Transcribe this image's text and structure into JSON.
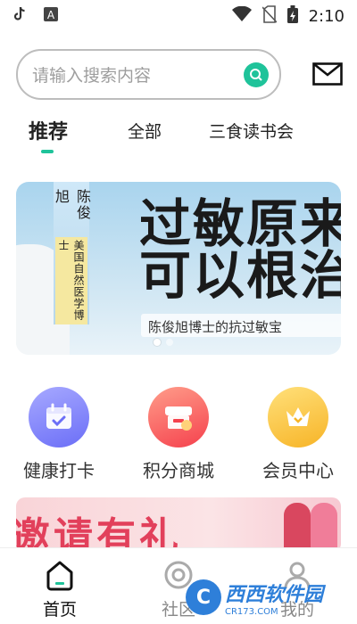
{
  "status_bar": {
    "time": "2:10"
  },
  "search": {
    "placeholder": "请输入搜索内容"
  },
  "tabs": [
    {
      "label": "推荐",
      "active": true
    },
    {
      "label": "全部",
      "active": false
    },
    {
      "label": "三食读书会",
      "active": false
    }
  ],
  "banner": {
    "author_name": "陈俊旭",
    "author_title": "美国自然医学博士",
    "headline_line1": "过敏原来",
    "headline_line2": "可以根治",
    "subtitle": "陈俊旭博士的抗过敏宝",
    "carousel_index": 1,
    "carousel_count": 2
  },
  "quick_actions": [
    {
      "label": "健康打卡",
      "icon": "calendar-check-icon",
      "color_from": "#a7a9ff",
      "color_to": "#6b6ef7"
    },
    {
      "label": "积分商城",
      "icon": "store-icon",
      "color_from": "#ff9d8a",
      "color_to": "#f5414d"
    },
    {
      "label": "会员中心",
      "icon": "crown-icon",
      "color_from": "#ffe07a",
      "color_to": "#f7b427"
    }
  ],
  "promo_banner": {
    "text": "邀请有礼"
  },
  "bottom_nav": [
    {
      "label": "首页",
      "icon": "home-icon",
      "active": true
    },
    {
      "label": "社区",
      "icon": "community-icon",
      "active": false
    },
    {
      "label": "我的",
      "icon": "profile-icon",
      "active": false
    }
  ],
  "watermark": {
    "brand": "西西软件园",
    "domain": "CR173.COM"
  },
  "colors": {
    "accent": "#1fc39a",
    "text": "#222222"
  }
}
